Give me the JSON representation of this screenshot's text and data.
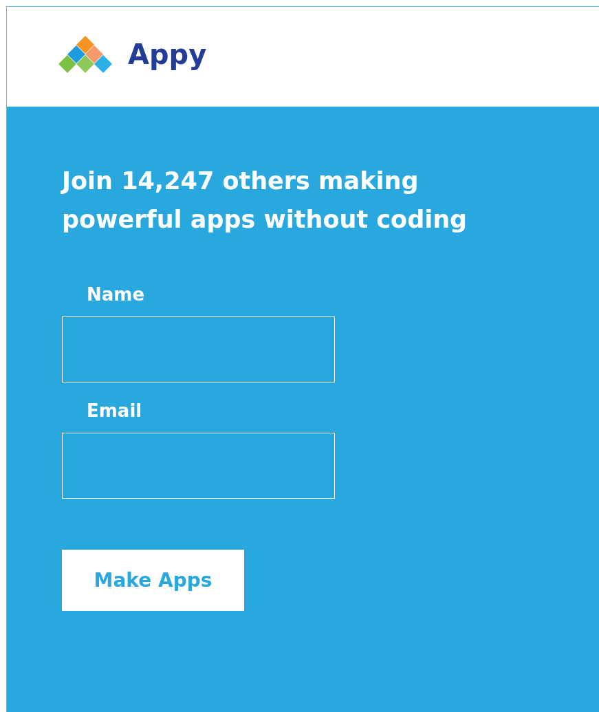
{
  "header": {
    "brand": "Appy"
  },
  "signup": {
    "heading": "Join 14,247 others making powerful apps without coding",
    "fields": [
      {
        "label": "Name"
      },
      {
        "label": "Email"
      }
    ],
    "button": "Make Apps"
  }
}
